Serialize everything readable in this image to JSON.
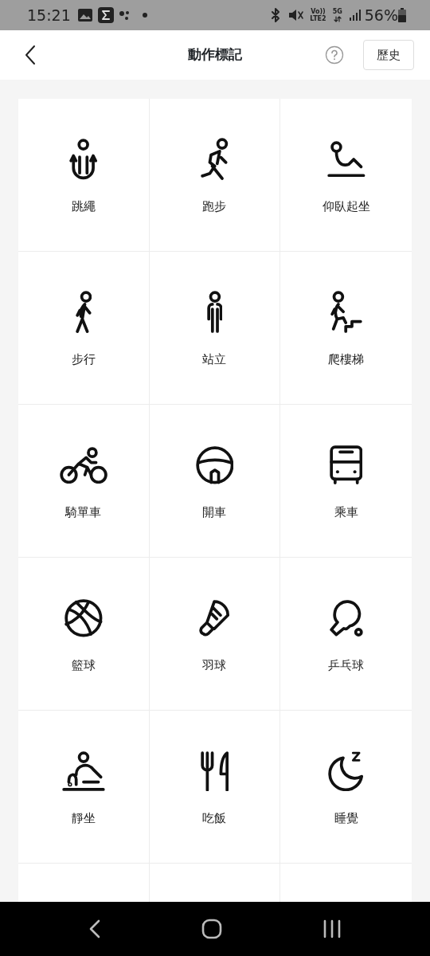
{
  "status_bar": {
    "time": "15:21",
    "network_labels": [
      "Vo))",
      "LTE2",
      "5G"
    ],
    "battery": "56%"
  },
  "header": {
    "title": "動作標記",
    "history_button": "歷史"
  },
  "activities": [
    {
      "label": "跳繩"
    },
    {
      "label": "跑步"
    },
    {
      "label": "仰臥起坐"
    },
    {
      "label": "步行"
    },
    {
      "label": "站立"
    },
    {
      "label": "爬樓梯"
    },
    {
      "label": "騎單車"
    },
    {
      "label": "開車"
    },
    {
      "label": "乘車"
    },
    {
      "label": "籃球"
    },
    {
      "label": "羽球"
    },
    {
      "label": "乒乓球"
    },
    {
      "label": "靜坐"
    },
    {
      "label": "吃飯"
    },
    {
      "label": "睡覺"
    }
  ]
}
